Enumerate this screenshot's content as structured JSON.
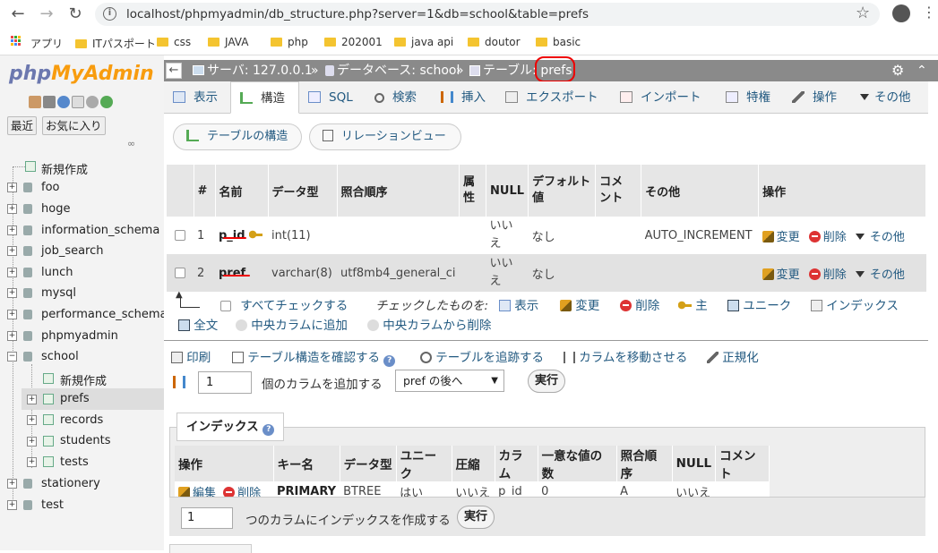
{
  "browser": {
    "url": "localhost/phpmyadmin/db_structure.php?server=1&db=school&table=prefs",
    "bookmarks": [
      {
        "label": "アプリ"
      },
      {
        "label": "ITパスポート"
      },
      {
        "label": "css"
      },
      {
        "label": "JAVA"
      },
      {
        "label": "php"
      },
      {
        "label": "202001"
      },
      {
        "label": "java api"
      },
      {
        "label": "doutor"
      },
      {
        "label": "basic"
      }
    ]
  },
  "sidebar": {
    "logo_a": "php",
    "logo_b": "MyAdmin",
    "recent": "最近",
    "favorites": "お気に入り",
    "tree": [
      "新規作成",
      "foo",
      "hoge",
      "information_schema",
      "job_search",
      "lunch",
      "mysql",
      "performance_schema",
      "phpmyadmin",
      "school",
      "新規作成",
      "prefs",
      "records",
      "students",
      "tests",
      "stationery",
      "test"
    ]
  },
  "breadcrumb": {
    "server": "サーバ: 127.0.0.1",
    "sep": "»",
    "database": "データベース: school",
    "table": "テーブル: prefs"
  },
  "tabs": [
    "表示",
    "構造",
    "SQL",
    "検索",
    "挿入",
    "エクスポート",
    "インポート",
    "特権",
    "操作",
    "その他"
  ],
  "subtabs": {
    "structure": "テーブルの構造",
    "relation": "リレーションビュー"
  },
  "columns": {
    "headers": [
      "#",
      "名前",
      "データ型",
      "照合順序",
      "属性",
      "NULL",
      "デフォルト値",
      "コメント",
      "その他",
      "操作"
    ],
    "header_parts": {
      "attr": [
        "属",
        "性"
      ],
      "default": [
        "デフォルト",
        "値"
      ],
      "comment": [
        "コメ",
        "ント"
      ]
    },
    "null_parts": [
      "いい",
      "え"
    ],
    "rows": [
      {
        "num": "1",
        "name": "p_id",
        "type": "int(11)",
        "collation": "",
        "attr": "",
        "null": "いいえ",
        "default": "なし",
        "comment": "",
        "extra": "AUTO_INCREMENT"
      },
      {
        "num": "2",
        "name": "pref",
        "type": "varchar(8)",
        "collation": "utf8mb4_general_ci",
        "attr": "",
        "null": "いいえ",
        "default": "なし",
        "comment": "",
        "extra": ""
      }
    ],
    "actions": {
      "edit": "変更",
      "drop": "削除",
      "more": "その他"
    }
  },
  "bulk": {
    "check_all": "すべてチェックする",
    "with_selected": "チェックしたものを:",
    "browse": "表示",
    "change": "変更",
    "drop": "削除",
    "primary": "主",
    "unique": "ユニーク",
    "index": "インデックス",
    "fulltext": "全文",
    "add_central": "中央カラムに追加",
    "remove_central": "中央カラムから削除"
  },
  "links": {
    "print": "印刷",
    "propose": "テーブル構造を確認する",
    "track": "テーブルを追跡する",
    "move": "カラムを移動させる",
    "normalize": "正規化"
  },
  "addcolumn": {
    "count": "1",
    "label": "個のカラムを追加する",
    "position": "pref の後へ",
    "go": "実行"
  },
  "indexes": {
    "legend": "インデックス",
    "headers": [
      "操作",
      "キー名",
      "データ型",
      "ユニーク",
      "圧縮",
      "カラム",
      "一意な値の数",
      "照合順序",
      "NULL",
      "コメント"
    ],
    "row": {
      "edit": "編集",
      "drop": "削除",
      "keyname": "PRIMARY",
      "type": "BTREE",
      "unique": "はい",
      "packed": "いいえ",
      "column": "p_id",
      "cardinality": "0",
      "collation": "A",
      "null": "いいえ",
      "comment": ""
    },
    "create_count": "1",
    "create_label": "つのカラムにインデックスを作成する",
    "go": "実行"
  },
  "colors": {
    "accent": "#235a81",
    "topbar": "#8a8a8a",
    "annotation": "#e00000"
  }
}
